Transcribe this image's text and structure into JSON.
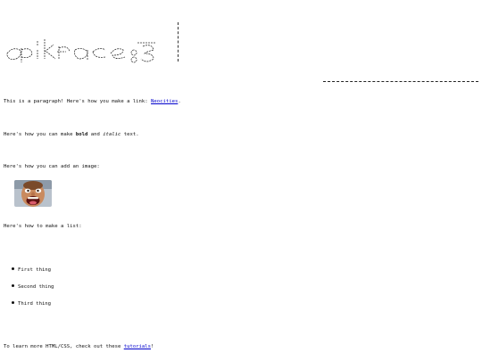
{
  "banner": {
    "title": "epikface :3"
  },
  "content": {
    "intro_text": "This is a paragraph! Here's how you make a link:",
    "intro_link": "Neocities",
    "intro_end": ".",
    "format_prefix": "Here's how you can make",
    "format_bold": "bold",
    "format_mid": "and",
    "format_italic": "italic",
    "format_end": "text.",
    "image_text": "Here's how you can add an image:",
    "list_text": "Here's how to make a list:",
    "list_items": [
      "First thing",
      "Second thing",
      "Third thing"
    ],
    "learn_text": "To learn more HTML/CSS, check out these",
    "learn_link": "tutorials",
    "learn_end": "!"
  },
  "colors": {
    "link": "#0000cc",
    "text": "#111111",
    "background": "#ffffff"
  }
}
